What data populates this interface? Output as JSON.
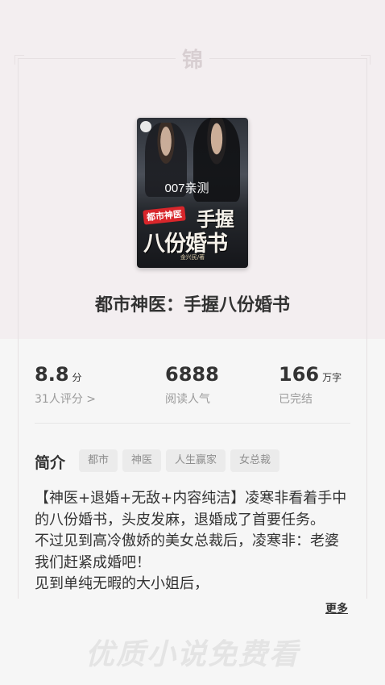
{
  "header": {
    "seal_char": "锦"
  },
  "cover": {
    "test_label": "007亲测",
    "series_tag": "都市神医",
    "title_line1": "手握",
    "title_line2": "八份婚书",
    "author": "金兴民/著"
  },
  "book": {
    "title": "都市神医：手握八份婚书"
  },
  "stats": {
    "rating": {
      "value": "8.8",
      "unit": "分",
      "sub": "31人评分 >"
    },
    "reads": {
      "value": "6888",
      "sub": "阅读人气"
    },
    "words": {
      "value": "166",
      "unit": "万字",
      "sub": "已完结"
    }
  },
  "intro": {
    "heading": "简介",
    "tags": [
      "都市",
      "神医",
      "人生赢家",
      "女总裁"
    ],
    "summary": "【神医+退婚+无敌+内容纯洁】凌寒非看着手中的八份婚书，头皮发麻，退婚成了首要任务。\n不过见到高冷傲娇的美女总裁后，凌寒非：老婆我们赶紧成婚吧！\n见到单纯无暇的大小姐后，",
    "more_label": "更多"
  },
  "footer": {
    "slogan": "优质小说免费看"
  },
  "colors": {
    "top_background": "#f3eef0",
    "bottom_background": "#f6f6f6",
    "text_primary": "#333333",
    "text_secondary": "#9a9a9a",
    "tag_background": "#ebebeb",
    "series_tag_red": "#d8262b"
  }
}
